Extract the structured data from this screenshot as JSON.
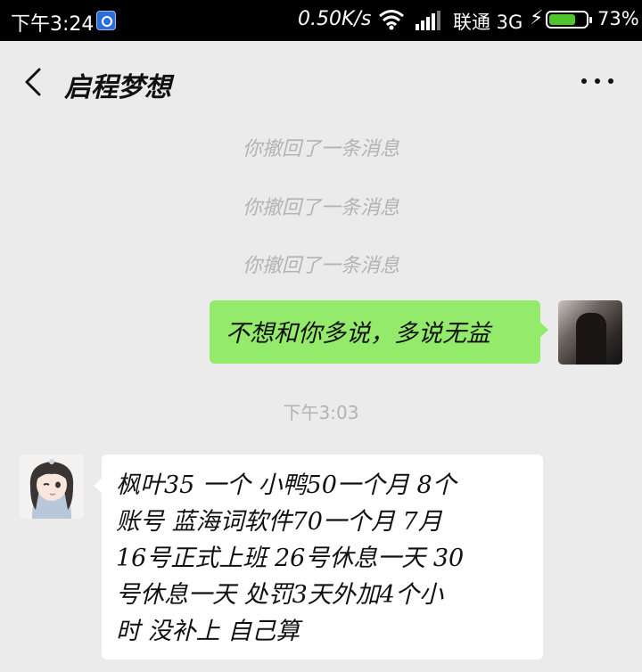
{
  "status_bar": {
    "time": "下午3:24",
    "app_icon": "browser-app-icon",
    "network_speed": "0.50K/s",
    "wifi_icon": "wifi-icon",
    "signal_icon": "signal-bars-icon",
    "carrier": "联通 3G",
    "charging_icon": "lightning-bolt-icon",
    "battery_level": 0.73,
    "battery_percent": "73%",
    "battery_color": "#4fc42f"
  },
  "header": {
    "back_icon": "chevron-left-icon",
    "title": "启程梦想",
    "more_icon": "more-horizontal-icon"
  },
  "notices": [
    "你撤回了一条消息",
    "你撤回了一条消息",
    "你撤回了一条消息"
  ],
  "timestamp": "下午3:03",
  "messages": {
    "sent": {
      "text": "不想和你多说，多说无益",
      "bubble_color": "#94ea6a"
    },
    "received": {
      "lines": [
        "枫叶35  一个  小鸭50一个月 8个",
        "账号  蓝海词软件70一个月  7月",
        "16号正式上班  26号休息一天  30",
        "号休息一天   处罚3天外加4个小",
        "时  没补上 自己算"
      ],
      "bubble_color": "#ffffff"
    }
  }
}
